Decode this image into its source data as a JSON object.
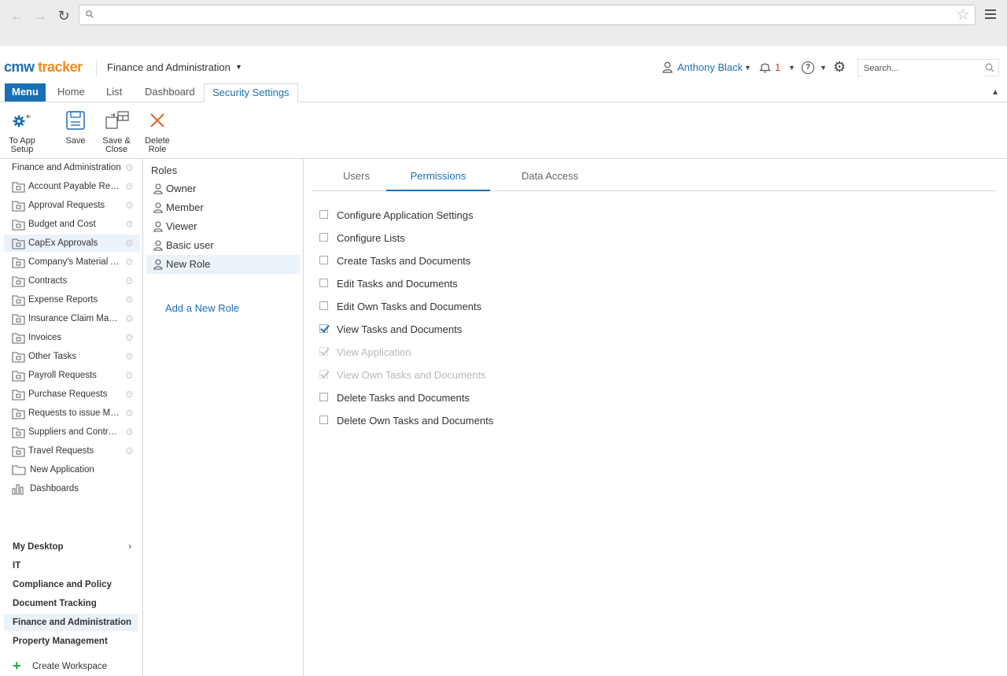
{
  "browser": {
    "url": ""
  },
  "header": {
    "logo_cmw": "cmw",
    "logo_tracker": "tracker",
    "workspace": "Finance and Administration",
    "user": "Anthony Black",
    "notifications": "1",
    "search_placeholder": "Search..."
  },
  "tabs": {
    "menu": "Menu",
    "home": "Home",
    "list": "List",
    "dashboard": "Dashboard",
    "security": "Security Settings"
  },
  "ribbon": {
    "to_app_setup_1": "To App",
    "to_app_setup_2": "Setup",
    "save": "Save",
    "save_close_1": "Save &",
    "save_close_2": "Close",
    "delete_role_1": "Delete",
    "delete_role_2": "Role"
  },
  "sidebar": {
    "head": "Finance and Administration",
    "apps": [
      "Account Payable Requests",
      "Approval Requests",
      "Budget and Cost",
      "CapEx Approvals",
      "Company's Material Assets",
      "Contracts",
      "Expense Reports",
      "Insurance Claim Management",
      "Invoices",
      "Other Tasks",
      "Payroll Requests",
      "Purchase Requests",
      "Requests to issue Materials",
      "Suppliers and Contractors",
      "Travel Requests"
    ],
    "new_app": "New Application",
    "dashboards": "Dashboards",
    "workspaces": [
      "My Desktop",
      "IT",
      "Compliance and Policy",
      "Document Tracking",
      "Finance and Administration",
      "Property Management"
    ],
    "create_workspace": "Create Workspace",
    "chevron": "›"
  },
  "roles": {
    "title": "Roles",
    "items": [
      "Owner",
      "Member",
      "Viewer",
      "Basic user",
      "New Role"
    ],
    "add": "Add a New Role"
  },
  "main": {
    "subtabs": [
      "Users",
      "Permissions",
      "Data Access"
    ],
    "permissions": [
      {
        "label": "Configure Application Settings",
        "checked": false,
        "disabled": false
      },
      {
        "label": "Configure Lists",
        "checked": false,
        "disabled": false
      },
      {
        "label": "Create Tasks and Documents",
        "checked": false,
        "disabled": false
      },
      {
        "label": "Edit Tasks and Documents",
        "checked": false,
        "disabled": false
      },
      {
        "label": "Edit Own Tasks and Documents",
        "checked": false,
        "disabled": false
      },
      {
        "label": "View Tasks and Documents",
        "checked": true,
        "disabled": false
      },
      {
        "label": "View Application",
        "checked": true,
        "disabled": true
      },
      {
        "label": "View Own Tasks and Documents",
        "checked": true,
        "disabled": true
      },
      {
        "label": "Delete Tasks and Documents",
        "checked": false,
        "disabled": false
      },
      {
        "label": "Delete Own Tasks and Documents",
        "checked": false,
        "disabled": false
      }
    ]
  },
  "colors": {
    "accent": "#1a6fb5",
    "logo_orange": "#f08c1e",
    "selected_bg": "#eaf2fa",
    "create_green": "#2fa52f"
  }
}
